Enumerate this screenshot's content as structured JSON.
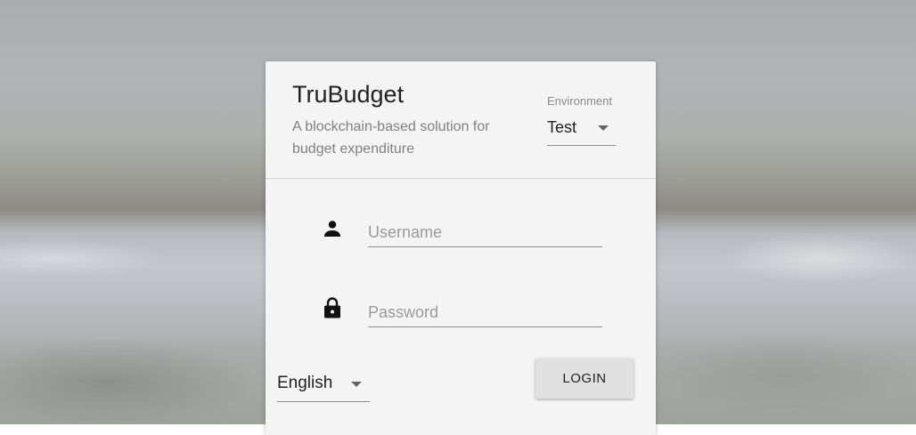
{
  "app": {
    "title": "TruBudget",
    "subtitle": "A blockchain-based solution for budget expenditure"
  },
  "environment": {
    "label": "Environment",
    "value": "Test",
    "icon": "chevron-down-icon"
  },
  "login_form": {
    "username": {
      "placeholder": "Username",
      "value": "",
      "icon": "person-icon"
    },
    "password": {
      "placeholder": "Password",
      "value": "",
      "icon": "lock-icon"
    },
    "language": {
      "value": "English",
      "icon": "chevron-down-icon"
    },
    "login_label": "LOGIN"
  },
  "colors": {
    "card_background": "#f4f4f5",
    "button_background": "#e0e0e0",
    "text_primary": "#222222",
    "text_secondary": "#808080"
  }
}
